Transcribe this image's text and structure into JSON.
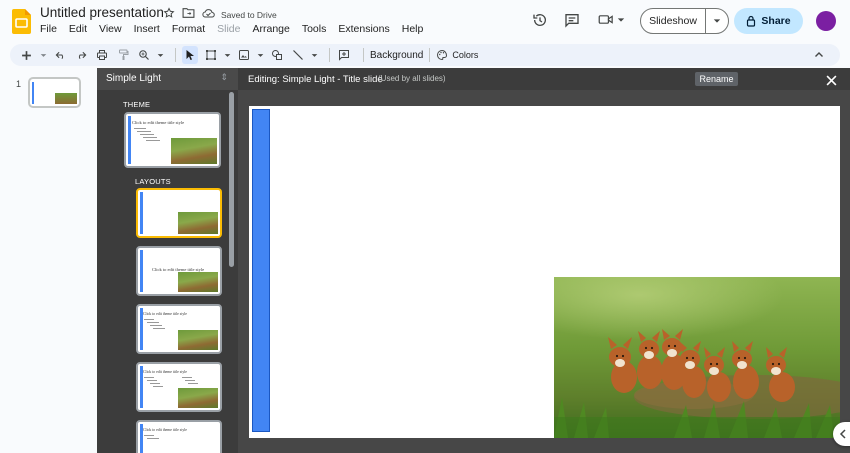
{
  "app": {
    "title": "Untitled presentation",
    "saved_status": "Saved to Drive",
    "menu": [
      "File",
      "Edit",
      "View",
      "Insert",
      "Format",
      "Slide",
      "Arrange",
      "Tools",
      "Extensions",
      "Help"
    ],
    "disabled_menu": "Slide"
  },
  "header": {
    "slideshow_label": "Slideshow",
    "share_label": "Share",
    "avatar_color": "#7b1fa2"
  },
  "toolbar": {
    "background_label": "Background",
    "colors_label": "Colors"
  },
  "filmstrip": {
    "slides": [
      {
        "number": "1"
      }
    ]
  },
  "theme_panel": {
    "name": "Simple Light",
    "theme_section": "THEME",
    "layouts_section": "LAYOUTS",
    "theme_thumb_text": "Click to edit theme title style",
    "layout_title_text": "Click to edit theme title style"
  },
  "editor": {
    "editing_title": "Editing: Simple Light - Title slide",
    "used_by": "(Used by all slides)",
    "rename_label": "Rename"
  },
  "colors": {
    "accent_blue": "#4285f4",
    "selection_yellow": "#fbbc04",
    "share_bg": "#c2e7ff",
    "dark_panel": "#3c3c3c"
  }
}
